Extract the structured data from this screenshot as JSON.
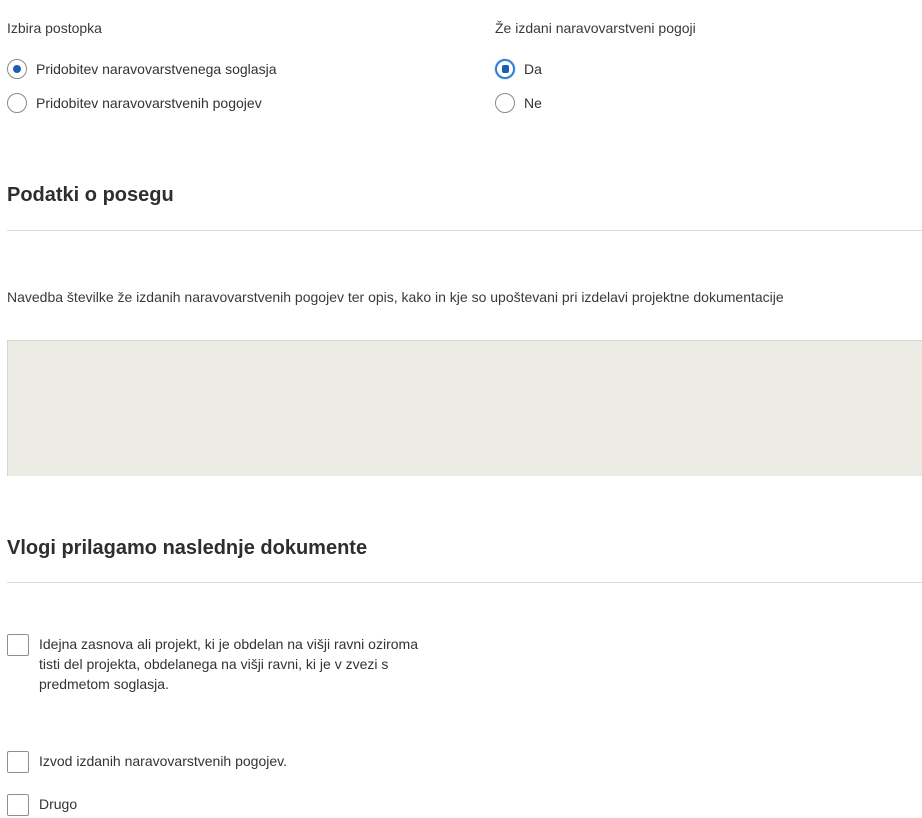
{
  "procedure": {
    "label": "Izbira postopka",
    "options": [
      {
        "label": "Pridobitev naravovarstvenega soglasja",
        "checked": true
      },
      {
        "label": "Pridobitev naravovarstvenih pogojev",
        "checked": false
      }
    ]
  },
  "conditions_issued": {
    "label": "Že izdani naravovarstveni pogoji",
    "options": [
      {
        "label": "Da",
        "checked": true
      },
      {
        "label": "Ne",
        "checked": false
      }
    ]
  },
  "section_intervention": {
    "title": "Podatki o posegu",
    "field_label": "Navedba številke že izdanih naravovarstvenih pogojev ter opis, kako in kje so upoštevani pri izdelavi projektne dokumentacije",
    "field_value": ""
  },
  "section_documents": {
    "title": "Vlogi prilagamo naslednje dokumente",
    "items": [
      {
        "label": "Idejna zasnova ali projekt, ki je obdelan na višji ravni oziroma tisti del projekta, obdelanega na višji ravni, ki je v zvezi s predmetom soglasja.",
        "checked": false
      },
      {
        "label": "Izvod izdanih naravovarstvenih pogojev.",
        "checked": false
      },
      {
        "label": "Drugo",
        "checked": false
      }
    ]
  },
  "colors": {
    "radio_selected": "#1a5fb4",
    "focus_ring": "#2d7fd8",
    "textarea_bg": "#ecebe3",
    "divider": "#dcdcdc"
  }
}
